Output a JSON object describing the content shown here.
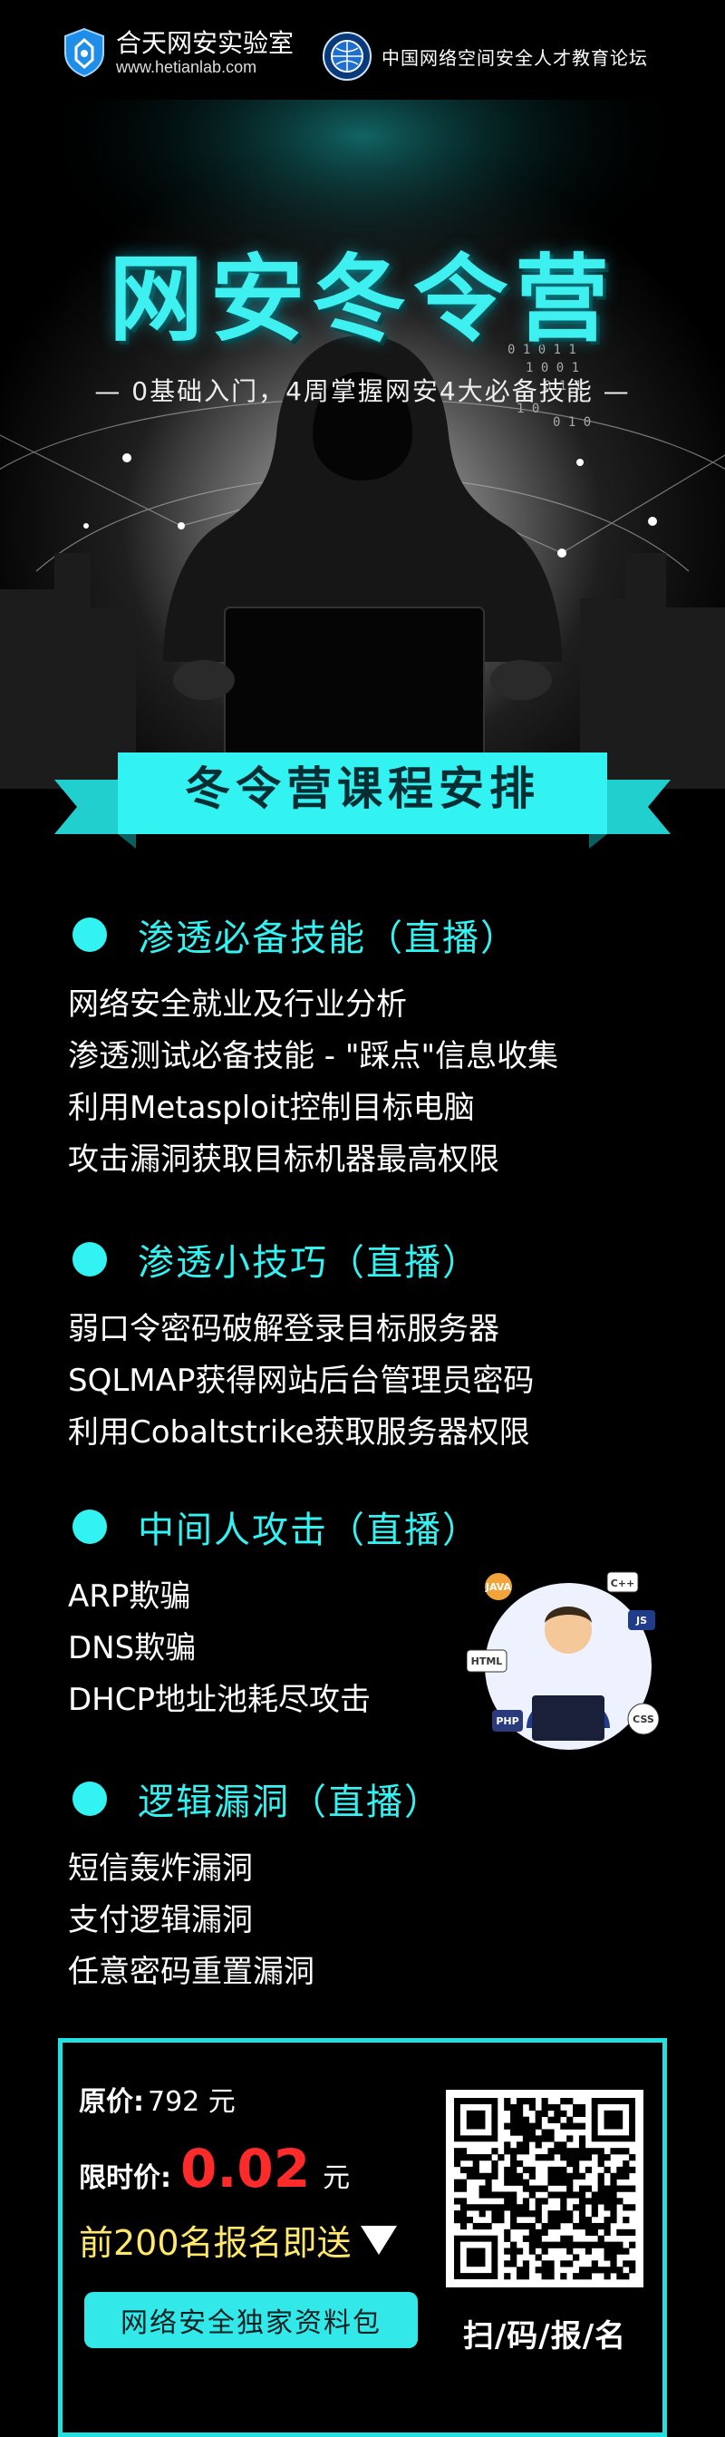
{
  "header": {
    "brand_name": "合天网安实验室",
    "brand_url": "www.hetianlab.com",
    "partner_name": "中国网络空间安全人才教育论坛"
  },
  "hero": {
    "title": "网安冬令营",
    "subtitle": "— 0基础入门，4周掌握网安4大必备技能 —"
  },
  "banner": {
    "title": "冬令营课程安排"
  },
  "sections": [
    {
      "title": "渗透必备技能（直播）",
      "items": [
        "网络安全就业及行业分析",
        "渗透测试必备技能 - \"踩点\"信息收集",
        "利用Metasploit控制目标电脑",
        "攻击漏洞获取目标机器最高权限"
      ]
    },
    {
      "title": "渗透小技巧（直播）",
      "items": [
        "弱口令密码破解登录目标服务器",
        "SQLMAP获得网站后台管理员密码",
        "利用Cobaltstrike获取服务器权限"
      ]
    },
    {
      "title": "中间人攻击（直播）",
      "items": [
        "ARP欺骗",
        "DNS欺骗",
        "DHCP地址池耗尽攻击"
      ]
    },
    {
      "title": "逻辑漏洞（直播）",
      "items": [
        "短信轰炸漏洞",
        "支付逻辑漏洞",
        "任意密码重置漏洞"
      ]
    }
  ],
  "illustration": {
    "tags": [
      "JAVA",
      "C++",
      "JS",
      "HTML",
      "PHP",
      "CSS"
    ]
  },
  "price": {
    "original_label": "原价:",
    "original_value": "792 元",
    "sale_label": "限时价:",
    "sale_value": "0.02",
    "sale_unit": "元",
    "gift_text": "前200名报名即送",
    "gift_button": "网络安全独家资料包",
    "qr_label": "扫/码/报/名"
  },
  "colors": {
    "accent": "#33f2f2",
    "sale": "#ff2b2b",
    "gift": "#ffe86a",
    "background": "#000000"
  }
}
